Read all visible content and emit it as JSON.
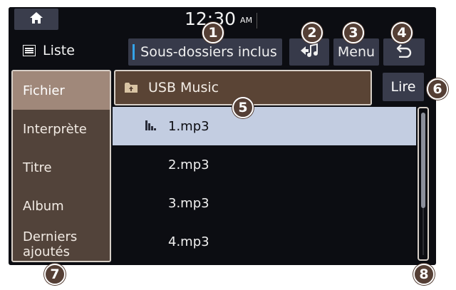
{
  "status_bar": {
    "home_icon": "home-icon",
    "clock_time": "12:30",
    "clock_ampm": "AM"
  },
  "toolbar": {
    "list_icon": "list-icon",
    "list_title": "Liste",
    "subfolders_label": "Sous-dossiers inclus",
    "music_icon": "music-return-icon",
    "menu_label": "Menu",
    "back_icon": "back-arrow-icon"
  },
  "sidebar": {
    "items": [
      {
        "label": "Fichier",
        "active": true
      },
      {
        "label": "Interprète",
        "active": false
      },
      {
        "label": "Titre",
        "active": false
      },
      {
        "label": "Album",
        "active": false
      },
      {
        "label": "Derniers ajoutés",
        "active": false
      }
    ]
  },
  "folder": {
    "icon": "folder-up-icon",
    "name": "USB Music",
    "play_label": "Lire"
  },
  "files": [
    {
      "name": "1.mp3",
      "active": true
    },
    {
      "name": "2.mp3",
      "active": false
    },
    {
      "name": "3.mp3",
      "active": false
    },
    {
      "name": "4.mp3",
      "active": false
    }
  ],
  "callouts": [
    "1",
    "2",
    "3",
    "4",
    "5",
    "6",
    "7",
    "8"
  ],
  "colors": {
    "background": "#0c0d12",
    "accent_brown": "#553f35",
    "selected_row": "#c3cde1",
    "active_tab": "#a0887a",
    "indicator_blue": "#34a3e8"
  }
}
